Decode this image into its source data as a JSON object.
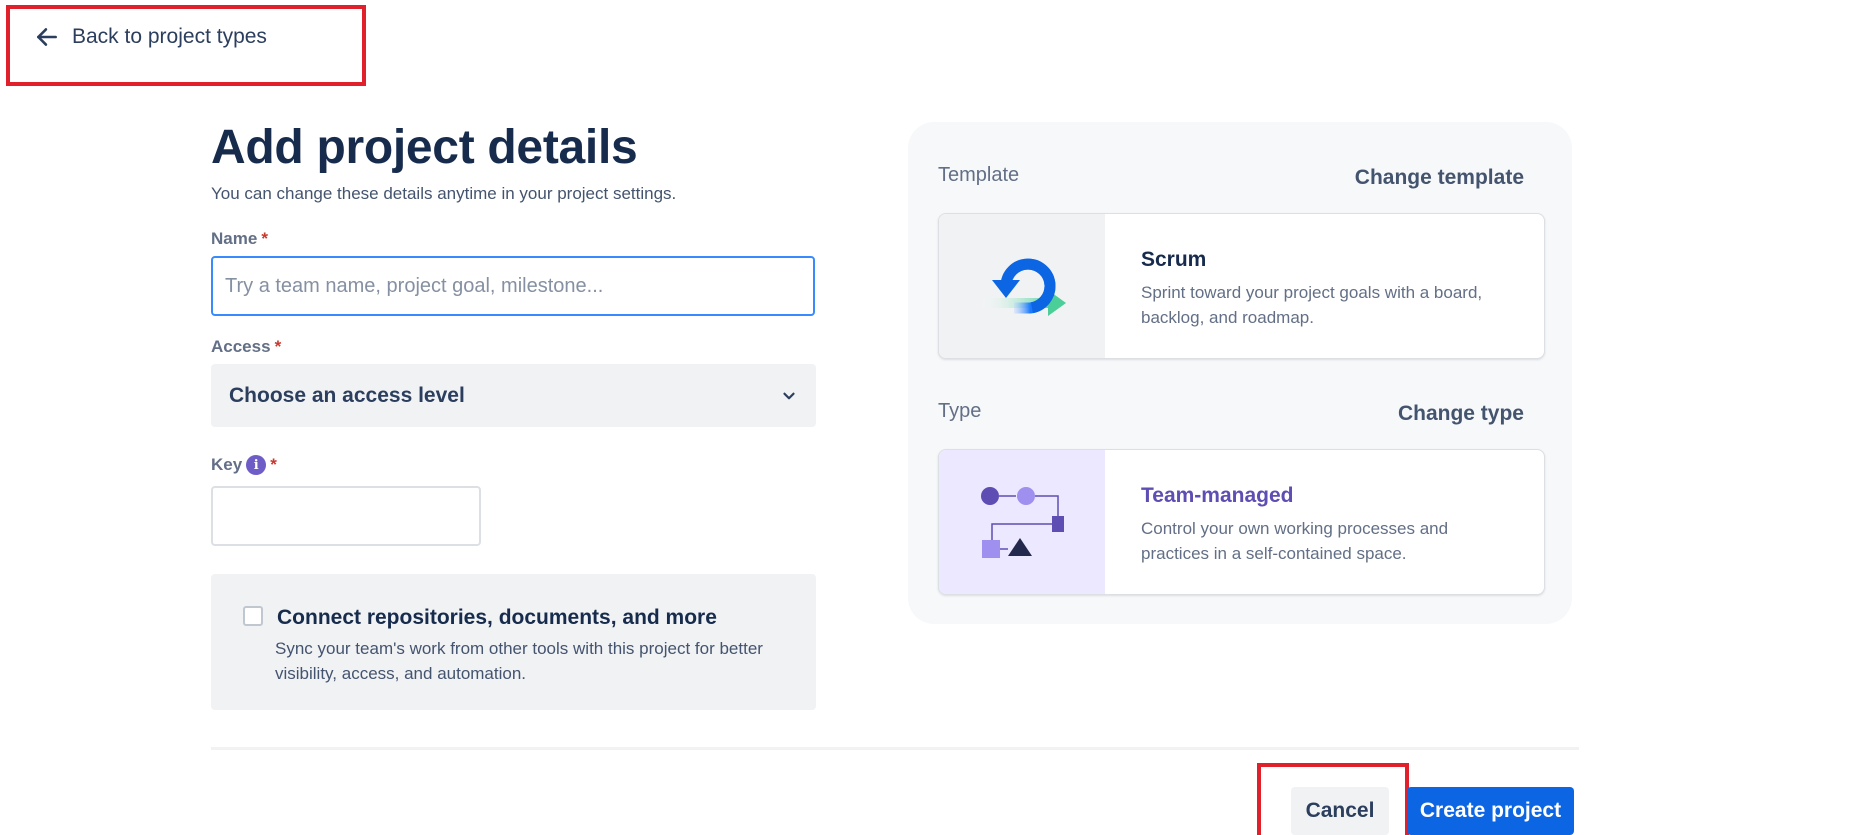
{
  "nav": {
    "back_label": "Back to project types"
  },
  "header": {
    "title": "Add project details",
    "subtitle": "You can change these details anytime in your project settings."
  },
  "form": {
    "name": {
      "label": "Name",
      "required_mark": "*",
      "placeholder": "Try a team name, project goal, milestone...",
      "value": ""
    },
    "access": {
      "label": "Access",
      "required_mark": "*",
      "selected": "Choose an access level"
    },
    "key": {
      "label": "Key",
      "info_icon": "i",
      "required_mark": "*",
      "value": ""
    },
    "connect": {
      "checked": false,
      "title": "Connect repositories, documents, and more",
      "description": "Sync your team's work from other tools with this project for better visibility, access, and automation."
    }
  },
  "side": {
    "template": {
      "label": "Template",
      "change_label": "Change template",
      "card": {
        "title": "Scrum",
        "description": "Sprint toward your project goals with a board, backlog, and roadmap.",
        "icon": "scrum-cycle-icon"
      }
    },
    "type": {
      "label": "Type",
      "change_label": "Change type",
      "card": {
        "title": "Team-managed",
        "description": "Control your own working processes and practices in a self-contained space.",
        "icon": "team-managed-flow-icon",
        "title_color": "#5e4db2",
        "art_bg": "#ece8ff"
      }
    }
  },
  "footer": {
    "cancel_label": "Cancel",
    "create_label": "Create project"
  },
  "colors": {
    "accent": "#0c66e4",
    "focus_border": "#388bff",
    "required": "#c9372c",
    "highlight": "#e0202a"
  }
}
